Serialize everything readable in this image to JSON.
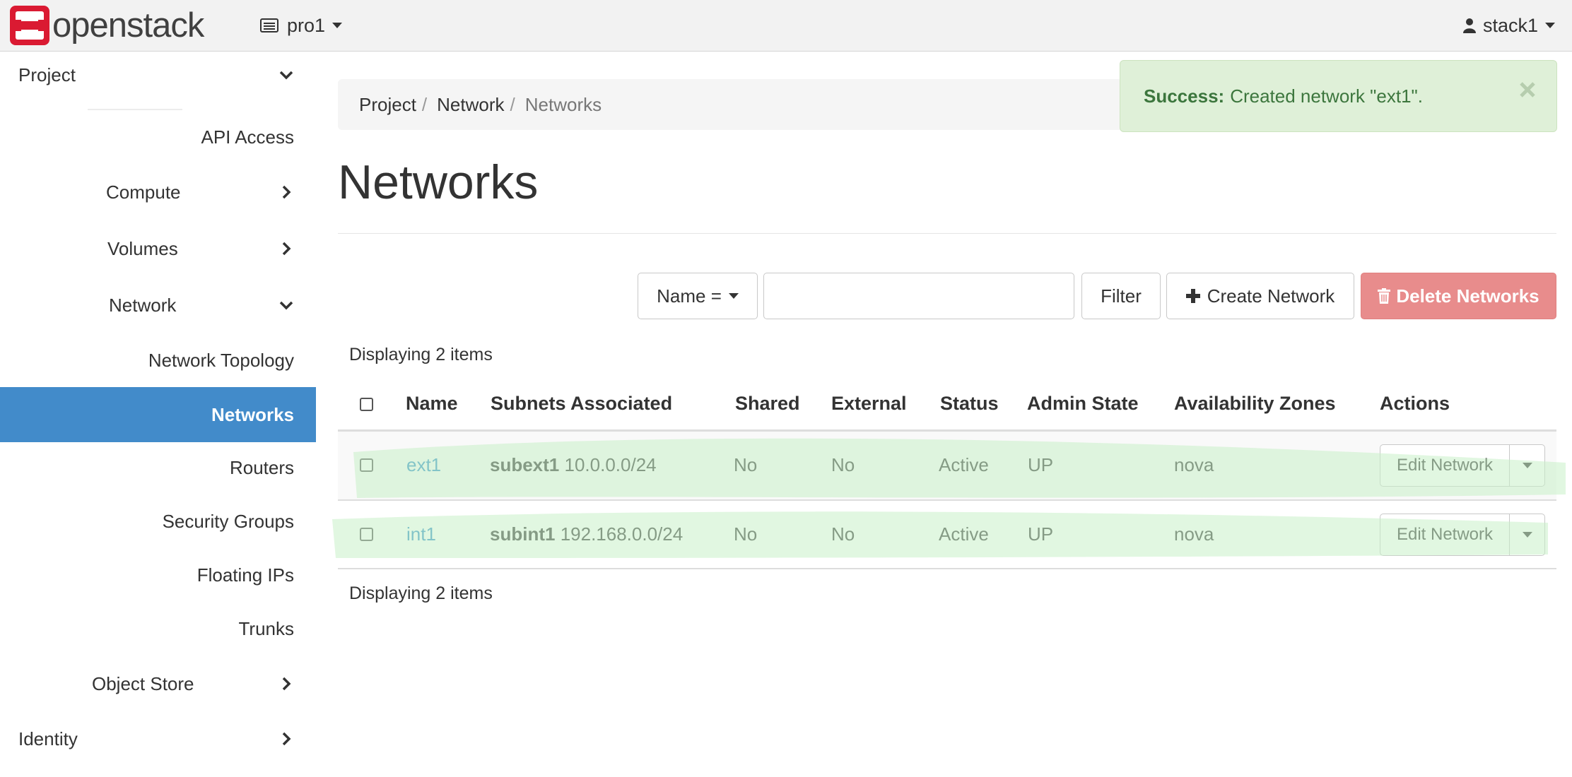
{
  "brand": {
    "name": "openstack"
  },
  "header": {
    "project": "pro1",
    "user": "stack1"
  },
  "sidebar": {
    "items": [
      {
        "label": "Project",
        "icon": "chevron-down-icon"
      },
      {
        "label": "API Access"
      },
      {
        "label": "Compute",
        "icon": "chevron-right-icon"
      },
      {
        "label": "Volumes",
        "icon": "chevron-right-icon"
      },
      {
        "label": "Network",
        "icon": "chevron-down-icon"
      },
      {
        "label": "Network Topology"
      },
      {
        "label": "Networks",
        "active": true
      },
      {
        "label": "Routers"
      },
      {
        "label": "Security Groups"
      },
      {
        "label": "Floating IPs"
      },
      {
        "label": "Trunks"
      },
      {
        "label": "Object Store",
        "icon": "chevron-right-icon"
      },
      {
        "label": "Identity",
        "icon": "chevron-right-icon"
      }
    ]
  },
  "breadcrumb": [
    "Project",
    "Network",
    "Networks"
  ],
  "breadcrumb_sep": "/",
  "alert": {
    "title": "Success:",
    "message": "Created network \"ext1\".",
    "color": "#dff0d8"
  },
  "page": {
    "title": "Networks"
  },
  "toolbar": {
    "filter_field": "Name =",
    "filter_value": "",
    "filter_button": "Filter",
    "create_button": "Create Network",
    "delete_button": "Delete Networks"
  },
  "count_text": "Displaying 2 items",
  "table": {
    "headers": [
      "Name",
      "Subnets Associated",
      "Shared",
      "External",
      "Status",
      "Admin State",
      "Availability Zones",
      "Actions"
    ],
    "rows": [
      {
        "name": "ext1",
        "subnet_name": "subext1",
        "subnet_cidr": "10.0.0.0/24",
        "shared": "No",
        "external": "No",
        "status": "Active",
        "admin_state": "UP",
        "zone": "nova",
        "action": "Edit Network"
      },
      {
        "name": "int1",
        "subnet_name": "subint1",
        "subnet_cidr": "192.168.0.0/24",
        "shared": "No",
        "external": "No",
        "status": "Active",
        "admin_state": "UP",
        "zone": "nova",
        "action": "Edit Network"
      }
    ]
  },
  "colors": {
    "accent": "#428bca",
    "danger": "#e88c8c",
    "link": "#2f8ec7",
    "highlight": "#c8f0c8"
  }
}
